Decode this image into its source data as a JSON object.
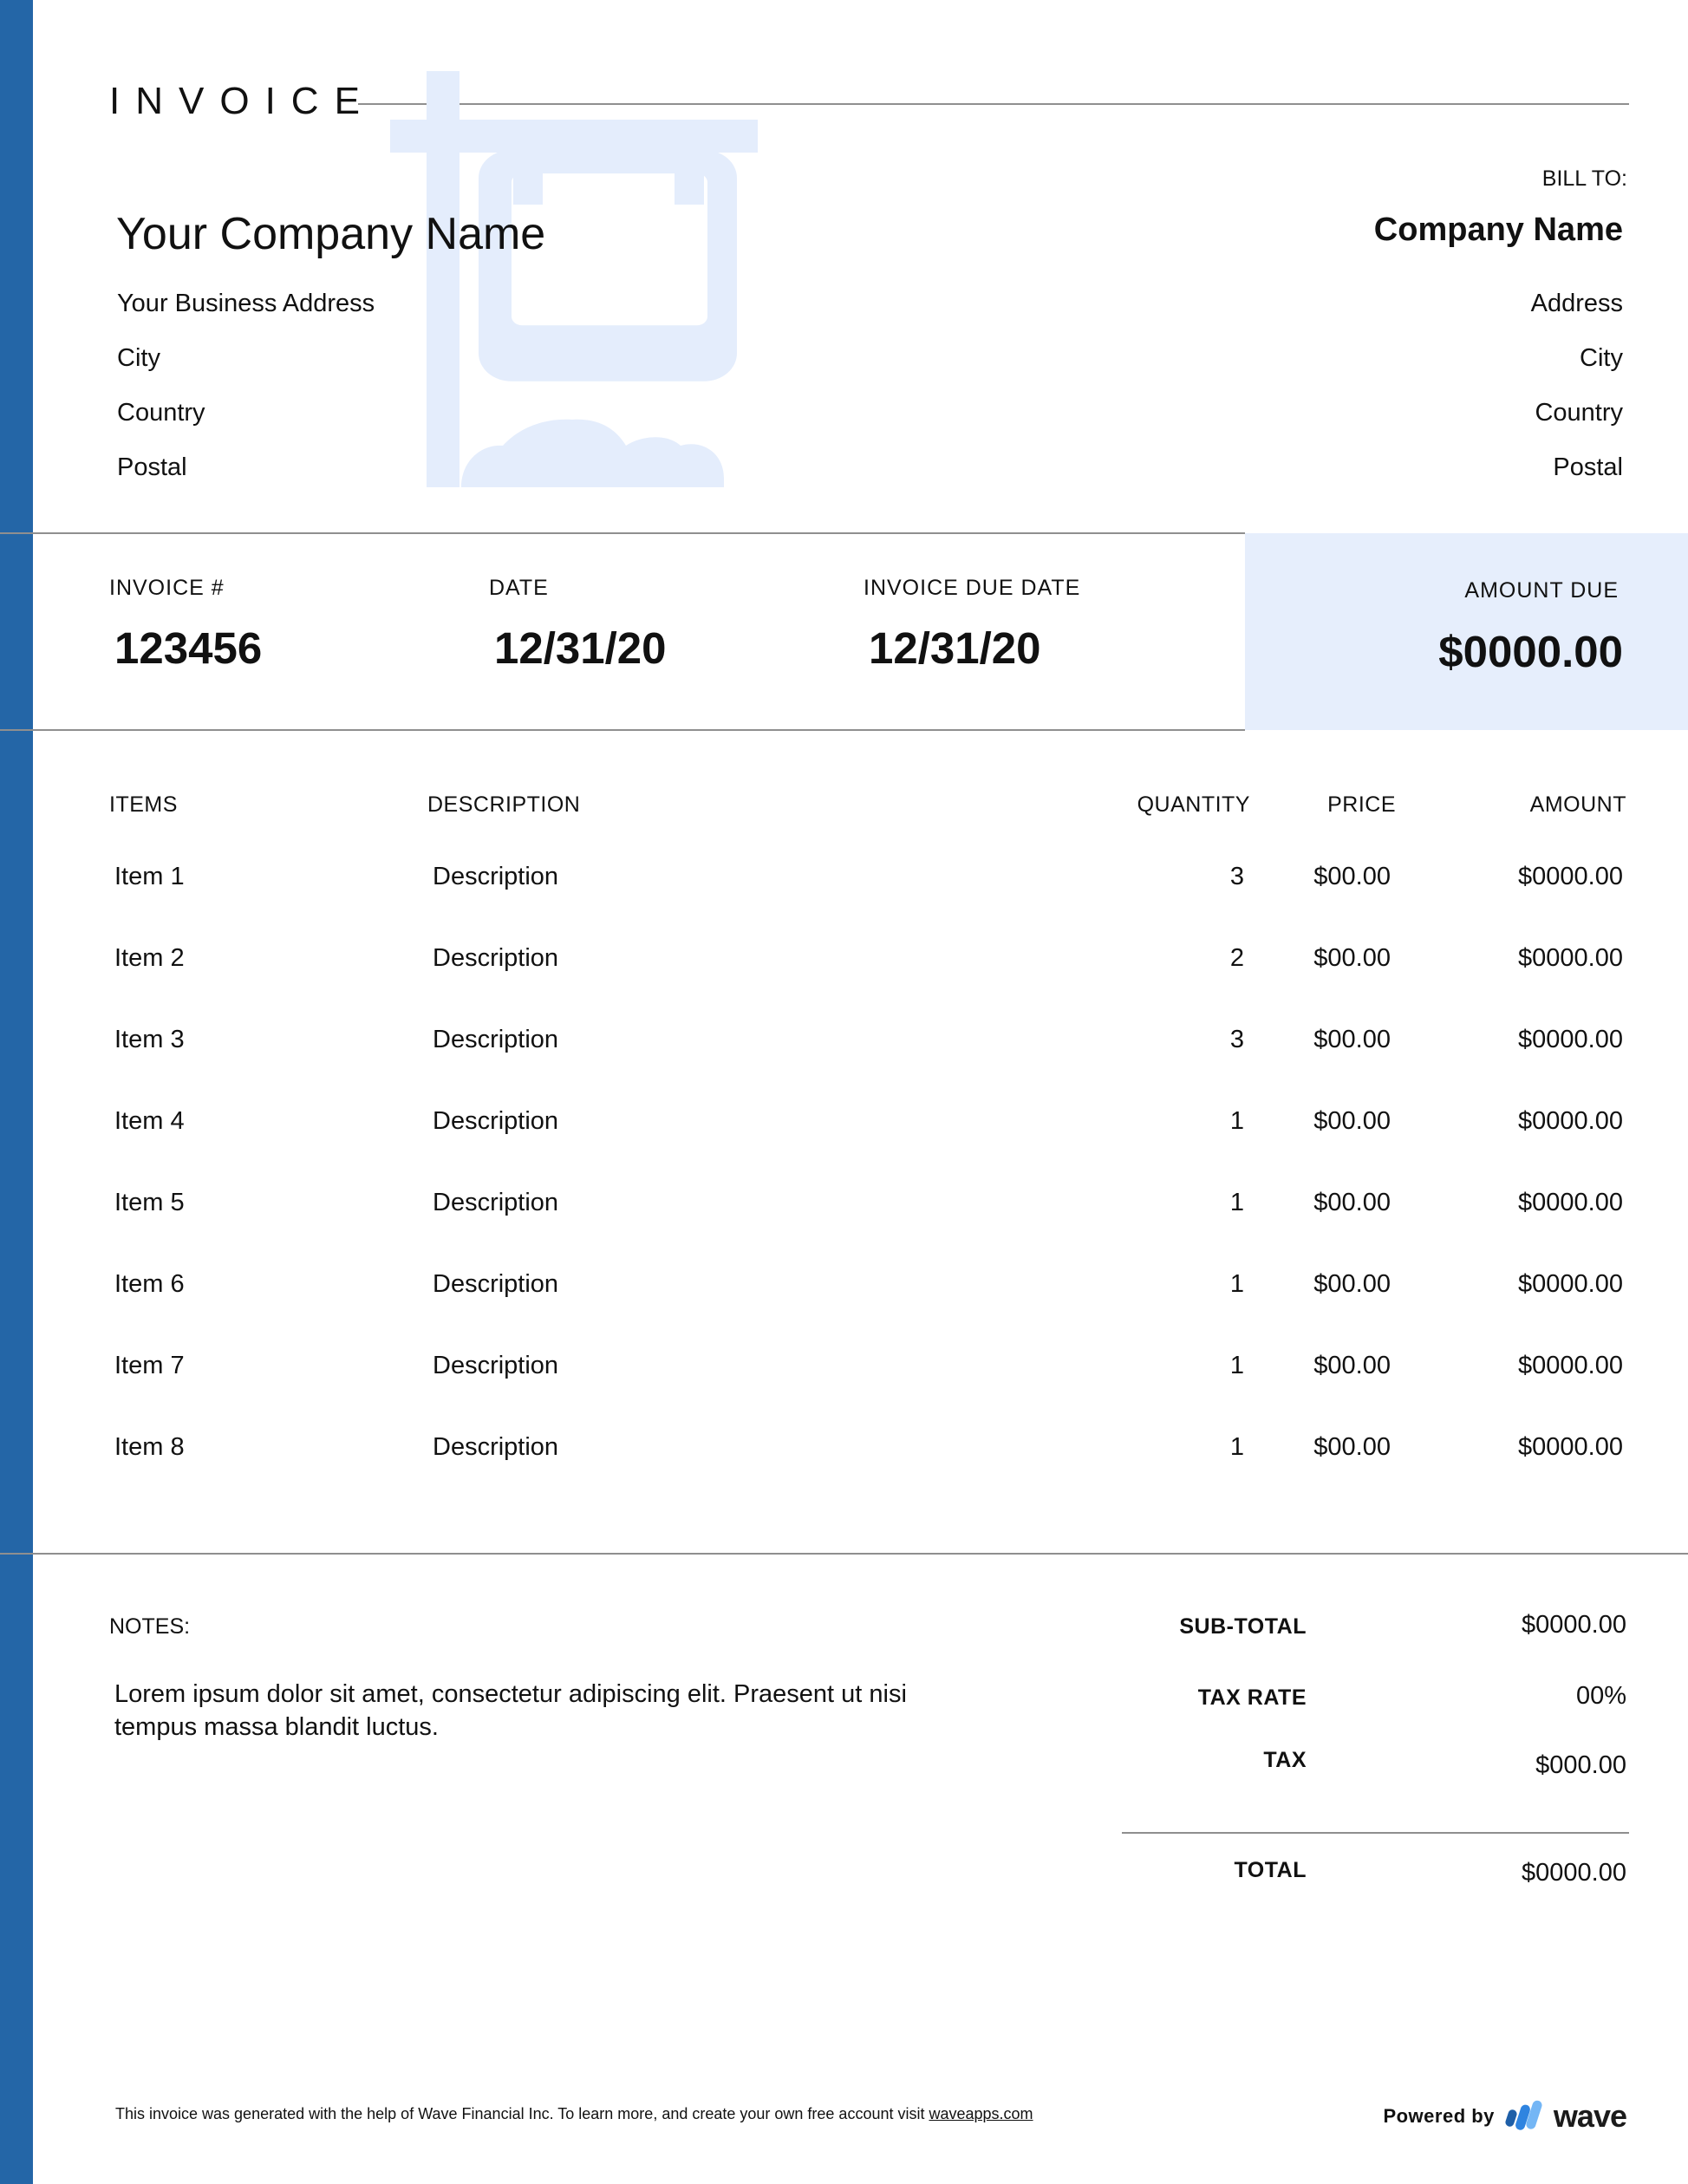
{
  "colors": {
    "sidebar": "#2466a7",
    "amount_due_bg": "#e6eefc",
    "watermark": "#e4edfc",
    "divider": "#8f8f8f"
  },
  "header": {
    "title": "INVOICE",
    "watermark_icon": "real-estate-sign-icon"
  },
  "from": {
    "company_name": "Your Company Name",
    "address": "Your Business Address",
    "city": "City",
    "country": "Country",
    "postal": "Postal"
  },
  "bill_to": {
    "label": "BILL TO:",
    "company_name": "Company Name",
    "address": "Address",
    "city": "City",
    "country": "Country",
    "postal": "Postal"
  },
  "meta": {
    "invoice_number_label": "INVOICE #",
    "invoice_number": "123456",
    "date_label": "DATE",
    "date": "12/31/20",
    "due_date_label": "INVOICE DUE DATE",
    "due_date": "12/31/20",
    "amount_due_label": "AMOUNT DUE",
    "amount_due": "$0000.00"
  },
  "table": {
    "columns": [
      "ITEMS",
      "DESCRIPTION",
      "QUANTITY",
      "PRICE",
      "AMOUNT"
    ],
    "rows": [
      {
        "item": "Item 1",
        "description": "Description",
        "quantity": "3",
        "price": "$00.00",
        "amount": "$0000.00"
      },
      {
        "item": "Item 2",
        "description": "Description",
        "quantity": "2",
        "price": "$00.00",
        "amount": "$0000.00"
      },
      {
        "item": "Item 3",
        "description": "Description",
        "quantity": "3",
        "price": "$00.00",
        "amount": "$0000.00"
      },
      {
        "item": "Item 4",
        "description": "Description",
        "quantity": "1",
        "price": "$00.00",
        "amount": "$0000.00"
      },
      {
        "item": "Item 5",
        "description": "Description",
        "quantity": "1",
        "price": "$00.00",
        "amount": "$0000.00"
      },
      {
        "item": "Item 6",
        "description": "Description",
        "quantity": "1",
        "price": "$00.00",
        "amount": "$0000.00"
      },
      {
        "item": "Item 7",
        "description": "Description",
        "quantity": "1",
        "price": "$00.00",
        "amount": "$0000.00"
      },
      {
        "item": "Item 8",
        "description": "Description",
        "quantity": "1",
        "price": "$00.00",
        "amount": "$0000.00"
      }
    ]
  },
  "notes": {
    "label": "NOTES:",
    "text": "Lorem ipsum dolor sit amet, consectetur adipiscing elit. Praesent ut nisi tempus massa blandit luctus."
  },
  "totals": {
    "subtotal_label": "SUB-TOTAL",
    "subtotal": "$0000.00",
    "tax_rate_label": "TAX RATE",
    "tax_rate": "00%",
    "tax_label": "TAX",
    "tax": "$000.00",
    "total_label": "TOTAL",
    "total": "$0000.00"
  },
  "footer": {
    "text": "This invoice was generated with the help of Wave Financial Inc. To learn more, and create your own free account visit ",
    "link_text": "waveapps.com",
    "powered_by": "Powered by",
    "brand": "wave",
    "brand_icon": "wave-logo-icon"
  }
}
